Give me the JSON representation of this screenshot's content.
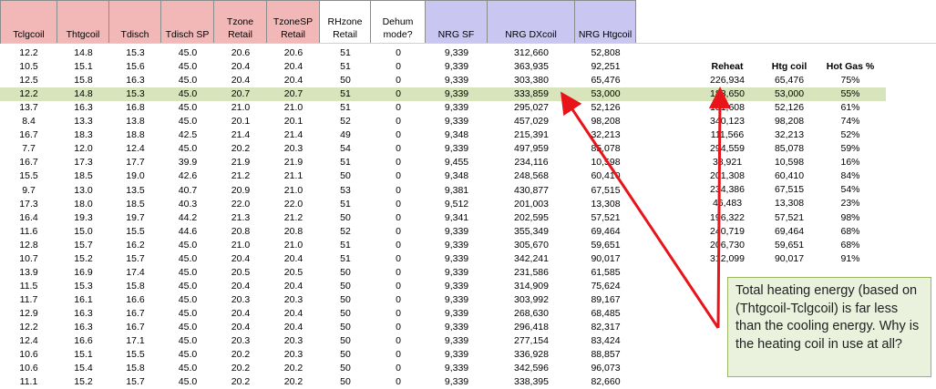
{
  "headers": [
    {
      "label": "Tclgcoil",
      "color": "pink"
    },
    {
      "label": "Thtgcoil",
      "color": "pink"
    },
    {
      "label": "Tdisch",
      "color": "pink"
    },
    {
      "label": "Tdisch SP",
      "color": "pink"
    },
    {
      "label": "Tzone\nRetail",
      "color": "pink"
    },
    {
      "label": "TzoneSP\nRetail",
      "color": "pink"
    },
    {
      "label": "RHzone\nRetail",
      "color": "white"
    },
    {
      "label": "Dehum\nmode?",
      "color": "white"
    },
    {
      "label": "NRG SF",
      "color": "blue"
    },
    {
      "label": "NRG DXcoil",
      "color": "blue"
    },
    {
      "label": "NRG Htgcoil",
      "color": "blue"
    }
  ],
  "rows": [
    [
      "12.2",
      "14.8",
      "15.3",
      "45.0",
      "20.6",
      "20.6",
      "51",
      "0",
      "9,339",
      "312,660",
      "52,808"
    ],
    [
      "10.5",
      "15.1",
      "15.6",
      "45.0",
      "20.4",
      "20.4",
      "51",
      "0",
      "9,339",
      "363,935",
      "92,251"
    ],
    [
      "12.5",
      "15.8",
      "16.3",
      "45.0",
      "20.4",
      "20.4",
      "50",
      "0",
      "9,339",
      "303,380",
      "65,476"
    ],
    [
      "12.2",
      "14.8",
      "15.3",
      "45.0",
      "20.7",
      "20.7",
      "51",
      "0",
      "9,339",
      "333,859",
      "53,000"
    ],
    [
      "13.7",
      "16.3",
      "16.8",
      "45.0",
      "21.0",
      "21.0",
      "51",
      "0",
      "9,339",
      "295,027",
      "52,126"
    ],
    [
      "8.4",
      "13.3",
      "13.8",
      "45.0",
      "20.1",
      "20.1",
      "52",
      "0",
      "9,339",
      "457,029",
      "98,208"
    ],
    [
      "16.7",
      "18.3",
      "18.8",
      "42.5",
      "21.4",
      "21.4",
      "49",
      "0",
      "9,348",
      "215,391",
      "32,213"
    ],
    [
      "7.7",
      "12.0",
      "12.4",
      "45.0",
      "20.2",
      "20.3",
      "54",
      "0",
      "9,339",
      "497,959",
      "85,078"
    ],
    [
      "16.7",
      "17.3",
      "17.7",
      "39.9",
      "21.9",
      "21.9",
      "51",
      "0",
      "9,455",
      "234,116",
      "10,598"
    ],
    [
      "15.5",
      "18.5",
      "19.0",
      "42.6",
      "21.2",
      "21.1",
      "50",
      "0",
      "9,348",
      "248,568",
      "60,410"
    ],
    [
      "9.7",
      "13.0",
      "13.5",
      "40.7",
      "20.9",
      "21.0",
      "53",
      "0",
      "9,381",
      "430,877",
      "67,515"
    ],
    [
      "17.3",
      "18.0",
      "18.5",
      "40.3",
      "22.0",
      "22.0",
      "51",
      "0",
      "9,512",
      "201,003",
      "13,308"
    ],
    [
      "16.4",
      "19.3",
      "19.7",
      "44.2",
      "21.3",
      "21.2",
      "50",
      "0",
      "9,341",
      "202,595",
      "57,521"
    ],
    [
      "11.6",
      "15.0",
      "15.5",
      "44.6",
      "20.8",
      "20.8",
      "52",
      "0",
      "9,339",
      "355,349",
      "69,464"
    ],
    [
      "12.8",
      "15.7",
      "16.2",
      "45.0",
      "21.0",
      "21.0",
      "51",
      "0",
      "9,339",
      "305,670",
      "59,651"
    ],
    [
      "10.7",
      "15.2",
      "15.7",
      "45.0",
      "20.4",
      "20.4",
      "51",
      "0",
      "9,339",
      "342,241",
      "90,017"
    ],
    [
      "13.9",
      "16.9",
      "17.4",
      "45.0",
      "20.5",
      "20.5",
      "50",
      "0",
      "9,339",
      "231,586",
      "61,585"
    ],
    [
      "11.5",
      "15.3",
      "15.8",
      "45.0",
      "20.4",
      "20.4",
      "50",
      "0",
      "9,339",
      "314,909",
      "75,624"
    ],
    [
      "11.7",
      "16.1",
      "16.6",
      "45.0",
      "20.3",
      "20.3",
      "50",
      "0",
      "9,339",
      "303,992",
      "89,167"
    ],
    [
      "12.9",
      "16.3",
      "16.7",
      "45.0",
      "20.4",
      "20.4",
      "50",
      "0",
      "9,339",
      "268,630",
      "68,485"
    ],
    [
      "12.2",
      "16.3",
      "16.7",
      "45.0",
      "20.4",
      "20.4",
      "50",
      "0",
      "9,339",
      "296,418",
      "82,317"
    ],
    [
      "12.4",
      "16.6",
      "17.1",
      "45.0",
      "20.3",
      "20.3",
      "50",
      "0",
      "9,339",
      "277,154",
      "83,424"
    ],
    [
      "10.6",
      "15.1",
      "15.5",
      "45.0",
      "20.2",
      "20.3",
      "50",
      "0",
      "9,339",
      "336,928",
      "88,857"
    ],
    [
      "10.6",
      "15.4",
      "15.8",
      "45.0",
      "20.2",
      "20.2",
      "50",
      "0",
      "9,339",
      "342,596",
      "96,073"
    ],
    [
      "11.1",
      "15.2",
      "15.7",
      "45.0",
      "20.2",
      "20.2",
      "50",
      "0",
      "9,339",
      "338,395",
      "82,660"
    ]
  ],
  "highlight_row": 3,
  "side_table": {
    "headers": [
      "Reheat",
      "Htg coil",
      "Hot Gas %"
    ],
    "rows": [
      [
        "226,934",
        "65,476",
        "75%"
      ],
      [
        "183,650",
        "53,000",
        "55%"
      ],
      [
        "181,608",
        "52,126",
        "61%"
      ],
      [
        "340,123",
        "98,208",
        "74%"
      ],
      [
        "111,566",
        "32,213",
        "52%"
      ],
      [
        "294,559",
        "85,078",
        "59%"
      ],
      [
        "38,921",
        "10,598",
        "16%"
      ],
      [
        "201,308",
        "60,410",
        "84%"
      ],
      [
        "234,386",
        "67,515",
        "54%"
      ],
      [
        "46,483",
        "13,308",
        "23%"
      ],
      [
        "196,322",
        "57,521",
        "98%"
      ],
      [
        "240,719",
        "69,464",
        "68%"
      ],
      [
        "206,730",
        "59,651",
        "68%"
      ],
      [
        "312,099",
        "90,017",
        "91%"
      ]
    ]
  },
  "callout": {
    "text": "Total heating energy (based on (Thtgcoil-Tclgcoil) is far less than the cooling energy. Why is the heating coil in use at all?"
  },
  "colors": {
    "header_pink": "#f2b8b8",
    "header_blue": "#c9c6f2",
    "highlight_green": "#d8e4bc",
    "callout_bg": "#eaf1dd",
    "arrow_red": "#e8141a"
  }
}
